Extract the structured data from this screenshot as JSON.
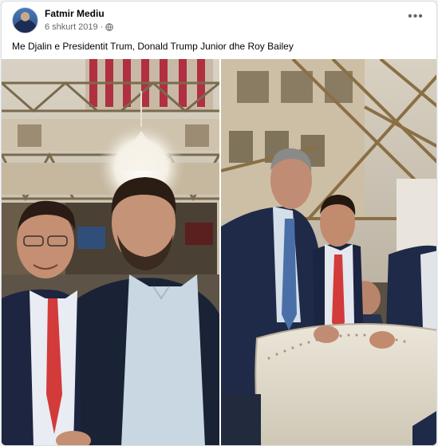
{
  "post": {
    "author": "Fatmir Mediu",
    "date": "6 shkurt 2019",
    "separator": "·",
    "privacy_icon": "globe-icon",
    "more_icon": "more-options-icon",
    "more_label": "•••",
    "caption": "Me Djalin e Presidentit Trum, Donald Trump Junior dhe Roy Bailey"
  },
  "photos": [
    {
      "id": "photo-left",
      "description_icon": "photo"
    },
    {
      "id": "photo-right",
      "description_icon": "photo"
    }
  ],
  "colors": {
    "accent": "#1877f2",
    "meta_text": "#65676b",
    "border": "#dadde1"
  }
}
